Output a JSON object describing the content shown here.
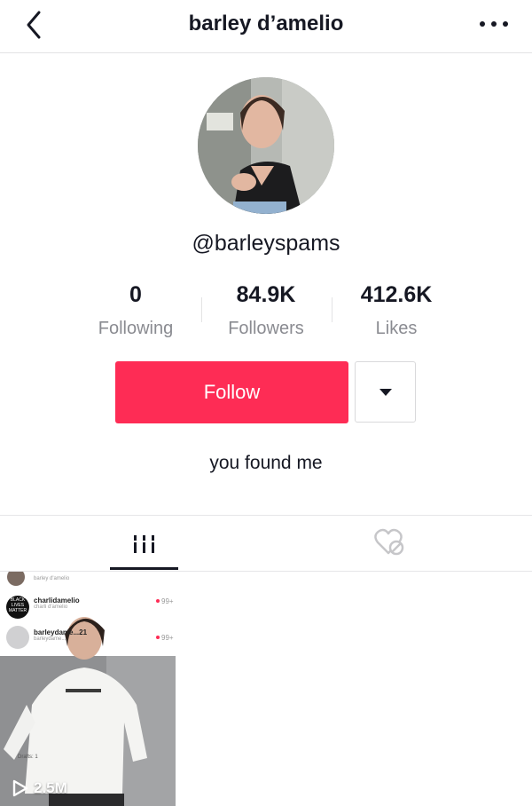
{
  "header": {
    "title": "barley d’amelio"
  },
  "profile": {
    "handle": "@barleyspams",
    "bio": "you found me"
  },
  "stats": [
    {
      "value": "0",
      "label": "Following"
    },
    {
      "value": "84.9K",
      "label": "Followers"
    },
    {
      "value": "412.6K",
      "label": "Likes"
    }
  ],
  "actions": {
    "follow_label": "Follow"
  },
  "tabs": [
    {
      "name": "videos",
      "icon": "videos-grid-icon",
      "active": true
    },
    {
      "name": "liked",
      "icon": "liked-hidden-icon",
      "active": false
    }
  ],
  "videos": [
    {
      "views": "2.5M",
      "thumbnail_text": {
        "row1_name": "barley d'amelio",
        "row2_name": "charlidamelio",
        "row2_sub": "charli d'amelio",
        "row2_badge": "99+",
        "row3_name": "barleydame...21",
        "row3_sub": "barleydame...",
        "row3_badge": "99+",
        "blm_text": "BLACK LIVES MATTER",
        "drafts": "Drafts: 1"
      }
    }
  ],
  "colors": {
    "accent": "#fe2c55",
    "text": "#161823",
    "muted": "#8a8b91"
  }
}
